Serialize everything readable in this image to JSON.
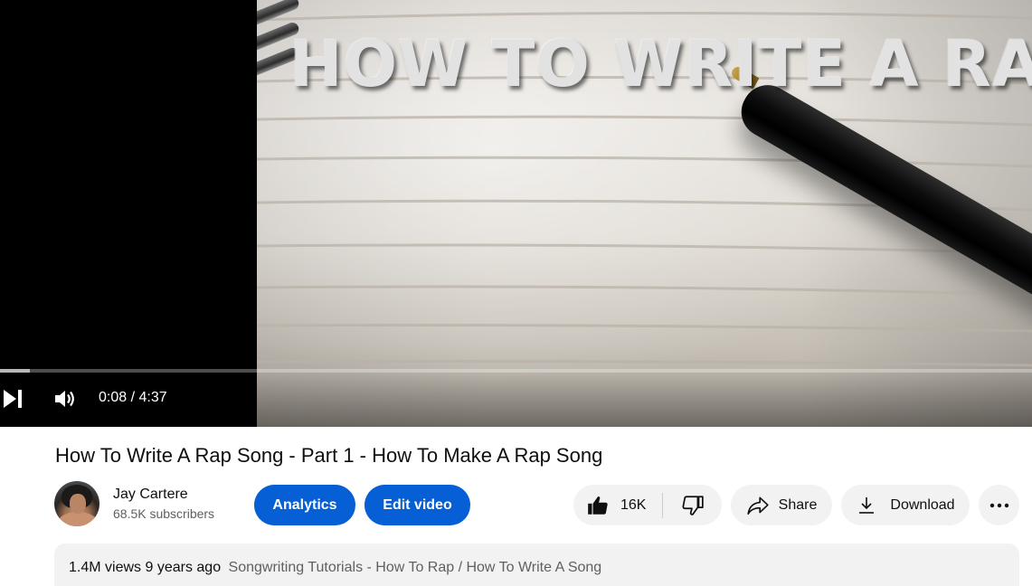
{
  "player": {
    "thumbnail_text": "HOW TO WRITE A RAP",
    "current_time": "0:08",
    "duration": "4:37",
    "time_display": "0:08 / 4:37",
    "progress_fraction": 0.029
  },
  "video": {
    "title": "How To Write A Rap Song - Part 1 - How To Make A Rap Song"
  },
  "channel": {
    "name": "Jay Cartere",
    "subscribers": "68.5K subscribers"
  },
  "actions": {
    "analytics_label": "Analytics",
    "edit_label": "Edit video",
    "like_count": "16K",
    "share_label": "Share",
    "download_label": "Download"
  },
  "description": {
    "views": "1.4M views",
    "age": "9 years ago",
    "tags": "Songwriting Tutorials - How To Rap / How To Write A Song"
  },
  "colors": {
    "accent": "#065fd4",
    "pill_bg": "#f2f2f2"
  }
}
